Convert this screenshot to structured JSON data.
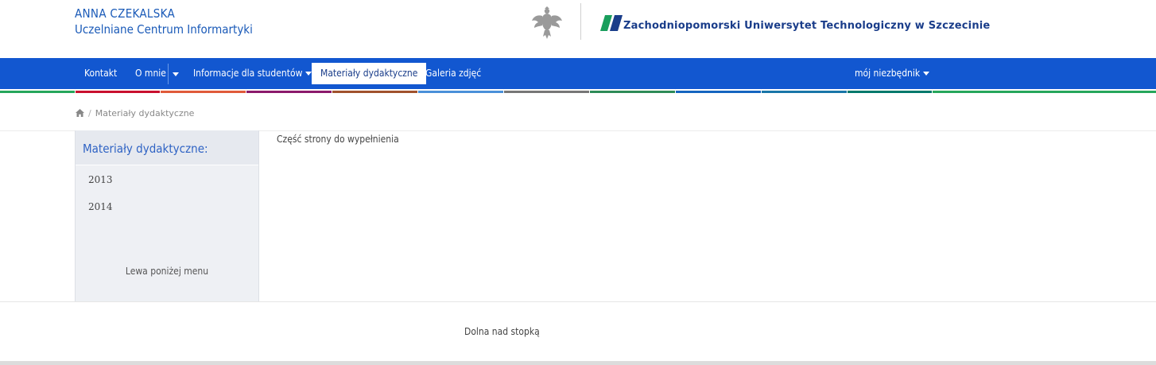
{
  "header": {
    "author": "ANNA CZEKALSKA",
    "unit": "Uczelniane Centrum Informartyki",
    "university": "Zachodniopomorski Uniwersytet Technologiczny w Szczecinie",
    "eagle_icon": "eagle-emblem-icon",
    "logo_icon": "zut-logo-icon"
  },
  "nav": {
    "items": [
      {
        "label": "Kontakt"
      },
      {
        "label": "O mnie"
      },
      {
        "label": "Informacje dla studentów"
      },
      {
        "label": "Materiały dydaktyczne"
      },
      {
        "label": "Galeria zdjęć"
      }
    ],
    "right": {
      "label": "mój niezbędnik"
    },
    "active_index": 3,
    "bg_color": "#1257d0"
  },
  "stripe_colors": [
    "#c8102e",
    "#e05a3a",
    "#8b1a6b",
    "#a0522d",
    "#4a90d9",
    "#777777",
    "#2e8b57",
    "#1565c0",
    "#1976a8",
    "#00796b",
    "#26a65b"
  ],
  "breadcrumb": {
    "home_icon": "home-icon",
    "separator": "/",
    "current": "Materiały dydaktyczne"
  },
  "sidebar": {
    "title": "Materiały dydaktyczne:",
    "items": [
      {
        "label": "2013"
      },
      {
        "label": "2014"
      }
    ],
    "footer": "Lewa poniżej menu"
  },
  "main": {
    "text": "Część strony do wypełnienia"
  },
  "footer": {
    "text": "Dolna nad stopką"
  }
}
